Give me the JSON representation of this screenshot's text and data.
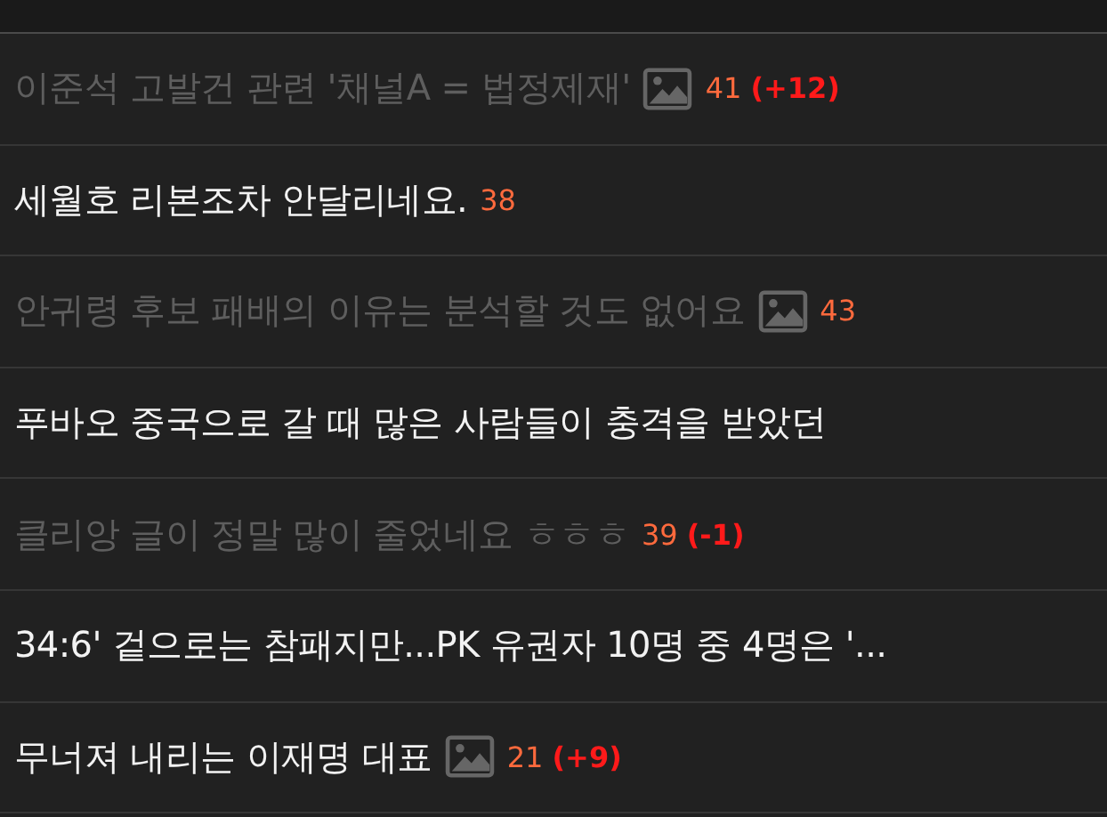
{
  "posts": [
    {
      "title": "이준석 고발건 관련 '채널A = 법정제재'",
      "read": true,
      "has_image": true,
      "comments": "41",
      "delta": "(+12)"
    },
    {
      "title": "세월호 리본조차 안달리네요.",
      "read": false,
      "has_image": false,
      "comments": "38"
    },
    {
      "title": "안귀령 후보 패배의 이유는 분석할 것도 없어요",
      "read": true,
      "has_image": true,
      "comments": "43"
    },
    {
      "title": "푸바오 중국으로 갈 때 많은 사람들이 충격을 받았던",
      "read": false,
      "has_image": false
    },
    {
      "title": "클리앙 글이 정말 많이 줄었네요 ㅎㅎㅎ",
      "read": true,
      "has_image": false,
      "comments": "39",
      "delta": "(-1)"
    },
    {
      "title": "34:6' 겉으로는 참패지만...PK 유권자 10명 중 4명은 '...",
      "read": false,
      "has_image": false
    },
    {
      "title": "무너져 내리는 이재명 대표",
      "read": false,
      "has_image": true,
      "comments": "21",
      "delta": "(+9)"
    }
  ]
}
